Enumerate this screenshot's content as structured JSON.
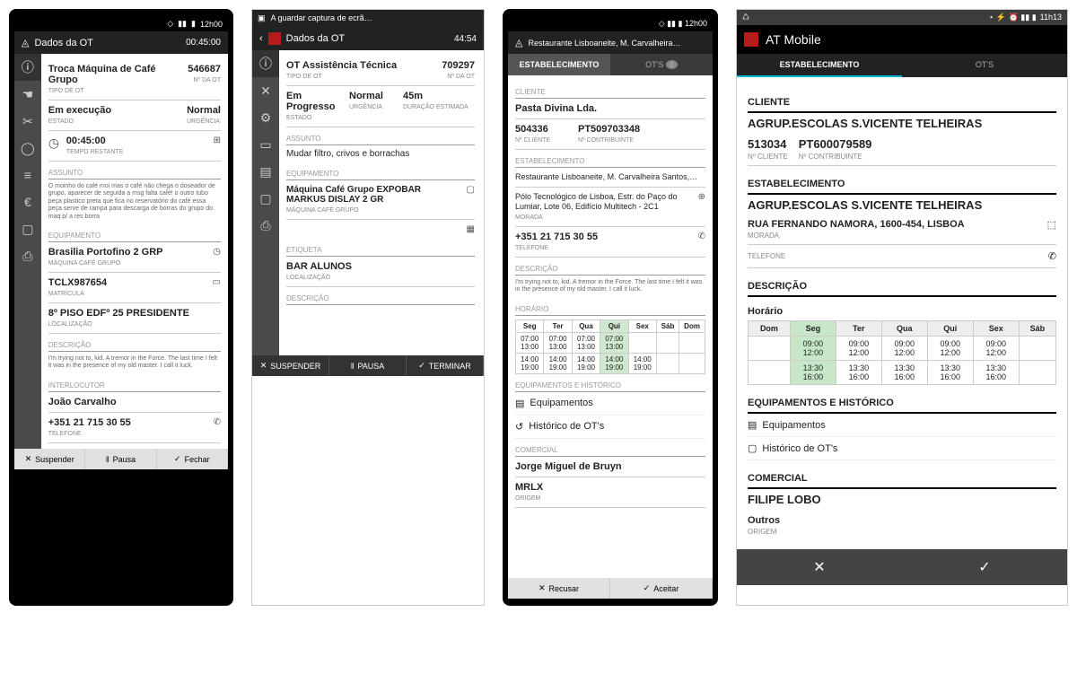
{
  "screen1": {
    "status_time": "12h00",
    "title": "Dados da OT",
    "elapsed": "00:45:00",
    "ot_name": "Troca Máquina de Café Grupo",
    "ot_type_lbl": "TIPO DE OT",
    "ot_num": "546687",
    "ot_num_lbl": "Nº DA OT",
    "state": "Em execução",
    "state_lbl": "ESTADO",
    "urgency": "Normal",
    "urgency_lbl": "URGÊNCIA",
    "timer": "00:45:00",
    "timer_lbl": "TEMPO RESTANTE",
    "assunto_h": "ASSUNTO",
    "assunto_text": "O moinho do café moi mas o café não chega o doseador de grupo, aparecer de seguida a msg falta café! o outro tubo peça plastico preta que fica no reservatório do café essa peça serve de rampa para descarga de borras do grupo do maq p/ a res borra",
    "equip_h": "EQUIPAMENTO",
    "equip1": "Brasilia Portofino 2 GRP",
    "equip1_lbl": "MÁQUINA CAFÉ GRUPO",
    "equip2": "TCLX987654",
    "equip2_lbl": "MATRÍCULA",
    "equip3": "8º PISO EDFº 25 PRESIDENTE",
    "equip3_lbl": "LOCALIZAÇÃO",
    "desc_h": "DESCRIÇÃO",
    "desc_text": "I'm trying not to, kid. A tremor in the Force. The last time I felt it was in the presence of my old master. I call it luck.",
    "inter_h": "INTERLOCUTOR",
    "inter_name": "João Carvalho",
    "inter_phone": "+351 21 715 30 55",
    "inter_phone_lbl": "TELEFONE",
    "btn_susp": "Suspender",
    "btn_pausa": "Pausa",
    "btn_fechar": "Fechar"
  },
  "screen2": {
    "saving": "A guardar captura de ecrã…",
    "title": "Dados da OT",
    "time": "44:54",
    "ot_name": "OT Assistência Técnica",
    "ot_type_lbl": "TIPO DE OT",
    "ot_num": "709297",
    "ot_num_lbl": "Nº DA OT",
    "state": "Em Progresso",
    "state_lbl": "ESTADO",
    "urgency": "Normal",
    "urgency_lbl": "URGÊNCIA",
    "duration": "45m",
    "duration_lbl": "DURAÇÃO ESTIMADA",
    "assunto_h": "ASSUNTO",
    "assunto_text": "Mudar filtro, crivos e borrachas",
    "equip_h": "EQUIPAMENTO",
    "equip1": "Máquina Café Grupo EXPOBAR MARKUS DISLAY 2 GR",
    "equip1_lbl": "MÁQUINA CAFÉ GRUPO",
    "etiq_h": "ETIQUETA",
    "etiq": "BAR ALUNOS",
    "etiq_lbl": "LOCALIZAÇÃO",
    "desc_h": "DESCRIÇÃO",
    "btn_susp": "SUSPENDER",
    "btn_pausa": "PAUSA",
    "btn_term": "TERMINAR"
  },
  "screen3": {
    "title": "Restaurante Lisboaneite, M. Carvalheira…",
    "tab_est": "ESTABELECIMENTO",
    "tab_ots": "OT's",
    "ots_badge": "4",
    "cli_h": "CLIENTE",
    "cli_name": "Pasta Divina Lda.",
    "cli_num": "504336",
    "cli_num_lbl": "Nº CLIENTE",
    "cli_contrib": "PT509703348",
    "cli_contrib_lbl": "Nº CONTRIBUINTE",
    "est_h": "ESTABELECIMENTO",
    "est_name": "Restaurante Lisboaneite, M. Carvalheira Santos,…",
    "addr": "Pólo Tecnológico de Lisboa, Estr. do Paço do Lumiar, Lote 06, Edifício Multitech - 2C1",
    "addr_lbl": "MORADA",
    "phone": "+351 21 715 30 55",
    "phone_lbl": "TELEFONE",
    "desc_h": "DESCRIÇÃO",
    "desc_text": "I'm trying not to, kid. A tremor in the Force. The last time I felt it was in the presence of my old master. I call it luck.",
    "hor_h": "HORÁRIO",
    "days": [
      "Seg",
      "Ter",
      "Qua",
      "Qui",
      "Sex",
      "Sáb",
      "Dom"
    ],
    "r1": [
      "07:00 13:00",
      "07:00 13:00",
      "07:00 13:00",
      "07:00 13:00",
      "",
      "",
      ""
    ],
    "r2": [
      "14:00 19:00",
      "14:00 19:00",
      "14:00 19:00",
      "14:00 19:00",
      "14:00 19:00",
      "",
      ""
    ],
    "eh_h": "EQUIPAMENTOS E HISTÓRICO",
    "eq_link": "Equipamentos",
    "hist_link": "Histórico de OT's",
    "com_h": "COMERCIAL",
    "com_name": "Jorge Miguel de Bruyn",
    "origem": "MRLX",
    "origem_lbl": "ORIGEM",
    "btn_rec": "Recusar",
    "btn_ace": "Aceitar"
  },
  "screen4": {
    "status_time": "11h13",
    "title": "AT Mobile",
    "tab_est": "ESTABELECIMENTO",
    "tab_ots": "OT'S",
    "cli_h": "CLIENTE",
    "cli_name": "AGRUP.ESCOLAS S.VICENTE TELHEIRAS",
    "cli_num": "513034",
    "cli_num_lbl": "Nº CLIENTE",
    "cli_contrib": "PT600079589",
    "cli_contrib_lbl": "Nº CONTRIBUINTE",
    "est_h": "ESTABELECIMENTO",
    "est_name": "AGRUP.ESCOLAS S.VICENTE TELHEIRAS",
    "addr": "RUA FERNANDO NAMORA, 1600-454, LISBOA",
    "addr_lbl": "MORADA",
    "tel_lbl": "TELEFONE",
    "desc_h": "DESCRIÇÃO",
    "hor_h": "Horário",
    "days": [
      "Dom",
      "Seg",
      "Ter",
      "Qua",
      "Qui",
      "Sex",
      "Sáb"
    ],
    "r1": [
      "",
      "09:00 12:00",
      "09:00 12:00",
      "09:00 12:00",
      "09:00 12:00",
      "09:00 12:00",
      ""
    ],
    "r2": [
      "",
      "13:30 16:00",
      "13:30 16:00",
      "13:30 16:00",
      "13:30 16:00",
      "13:30 16:00",
      ""
    ],
    "eh_h": "EQUIPAMENTOS E HISTÓRICO",
    "eq_link": "Equipamentos",
    "hist_link": "Histórico de OT's",
    "com_h": "COMERCIAL",
    "com_name": "FILIPE LOBO",
    "origem": "Outros",
    "origem_lbl": "ORIGEM"
  }
}
